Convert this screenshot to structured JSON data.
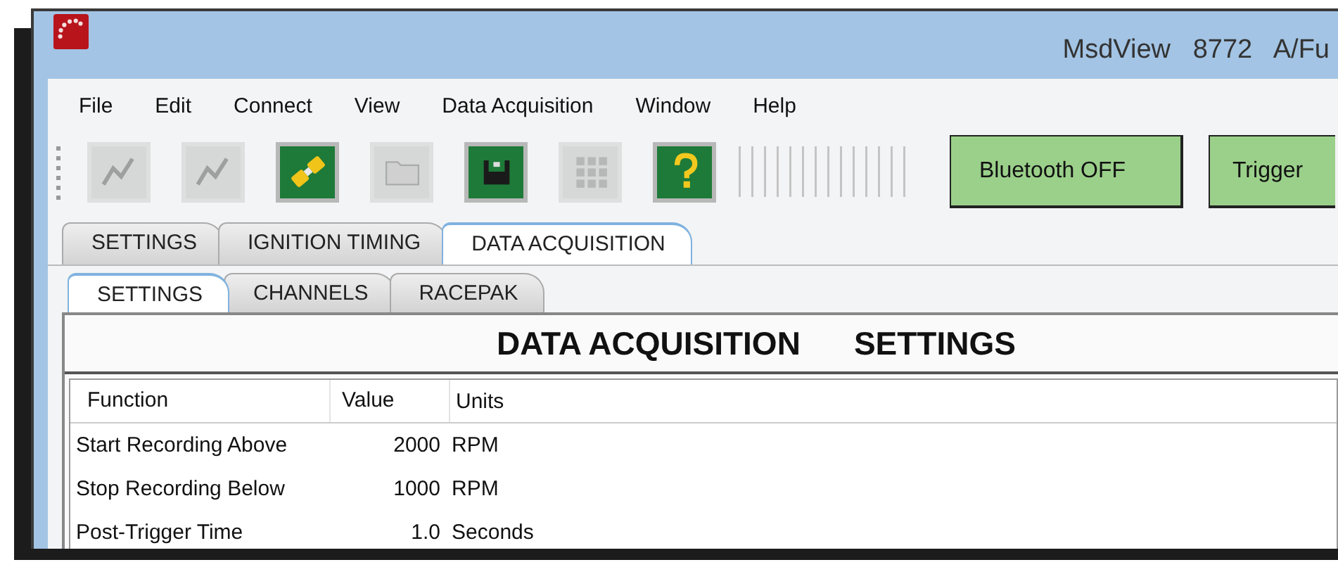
{
  "window": {
    "title": "MsdView   8772   A/Fu"
  },
  "menu": [
    "File",
    "Edit",
    "Connect",
    "View",
    "Data Acquisition",
    "Window",
    "Help"
  ],
  "toolbar": [
    {
      "kind": "chart",
      "disabled": true
    },
    {
      "kind": "chart",
      "disabled": true
    },
    {
      "kind": "plug",
      "disabled": false
    },
    {
      "kind": "folder",
      "disabled": true
    },
    {
      "kind": "save",
      "disabled": false
    },
    {
      "kind": "grid",
      "disabled": true
    },
    {
      "kind": "help",
      "disabled": false
    }
  ],
  "toolbar_buttons": [
    "Bluetooth OFF",
    "Trigger"
  ],
  "tabs": [
    {
      "label": "SETTINGS",
      "selected": false
    },
    {
      "label": "IGNITION TIMING",
      "selected": false
    },
    {
      "label": "DATA ACQUISITION",
      "selected": true
    }
  ],
  "subtabs": [
    {
      "label": "SETTINGS",
      "selected": true
    },
    {
      "label": "CHANNELS",
      "selected": false
    },
    {
      "label": "RACEPAK",
      "selected": false
    }
  ],
  "heading": [
    "DATA ACQUISITION",
    "SETTINGS"
  ],
  "table": {
    "columns": [
      "Function",
      "Value",
      "Units"
    ],
    "rows": [
      [
        "Start Recording Above",
        "2000",
        "RPM"
      ],
      [
        "Stop Recording Below",
        "1000",
        "RPM"
      ],
      [
        "Post-Trigger Time",
        "1.0",
        "Seconds"
      ]
    ]
  }
}
